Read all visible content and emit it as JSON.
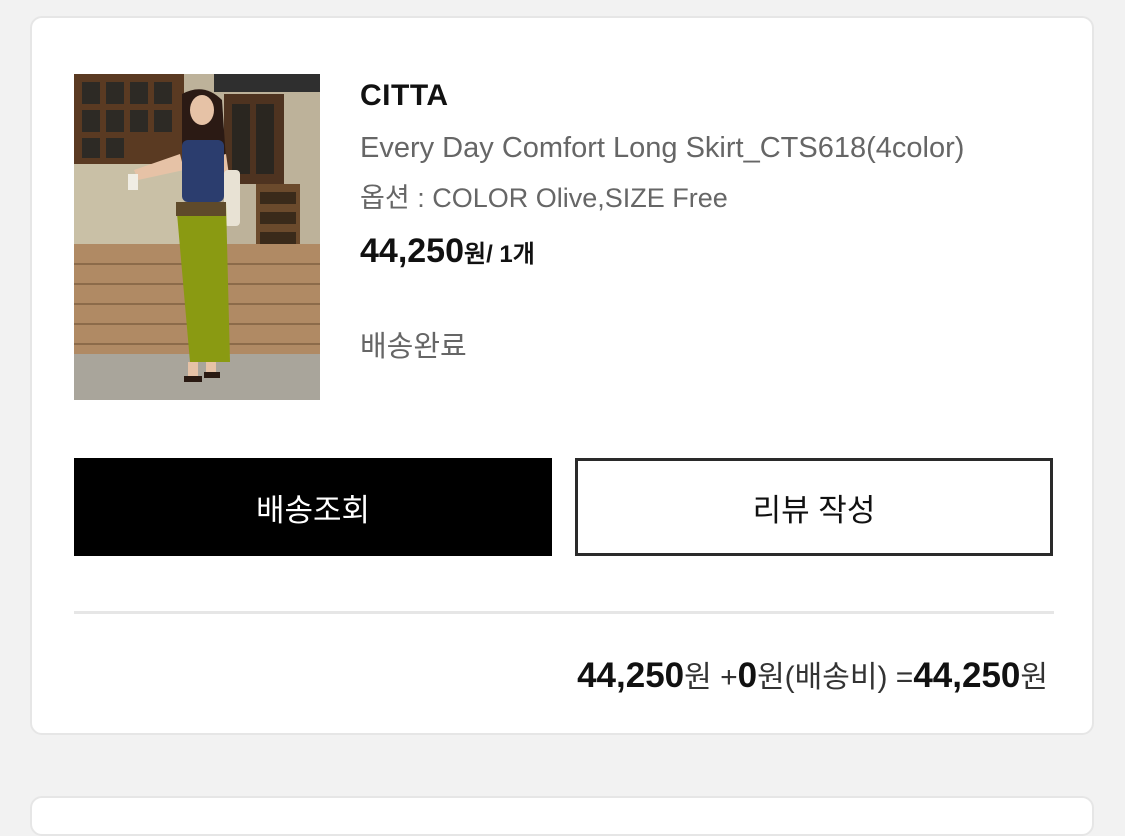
{
  "order_item": {
    "brand": "CITTA",
    "product_name": "Every Day Comfort Long Skirt_CTS618(4color)",
    "option_label": "옵션",
    "option_sep": " : ",
    "option_value": "COLOR Olive,SIZE Free",
    "price": "44,250",
    "price_unit": "원",
    "quantity": "/ 1개",
    "status": "배송완료",
    "image_icon": "product-photo"
  },
  "actions": {
    "track_label": "배송조회",
    "review_label": "리뷰 작성"
  },
  "summary": {
    "item_amount": "44,250",
    "item_unit": "원",
    "plus": " +",
    "shipping_amount": "0",
    "shipping_unit": "원(배송비)",
    "equals": " =",
    "total_amount": "44,250",
    "total_unit": "원"
  },
  "colors": {
    "primary_button_bg": "#000000",
    "secondary_button_border": "#2a2a2a",
    "muted_text": "#666666",
    "page_bg": "#f2f2f2"
  }
}
